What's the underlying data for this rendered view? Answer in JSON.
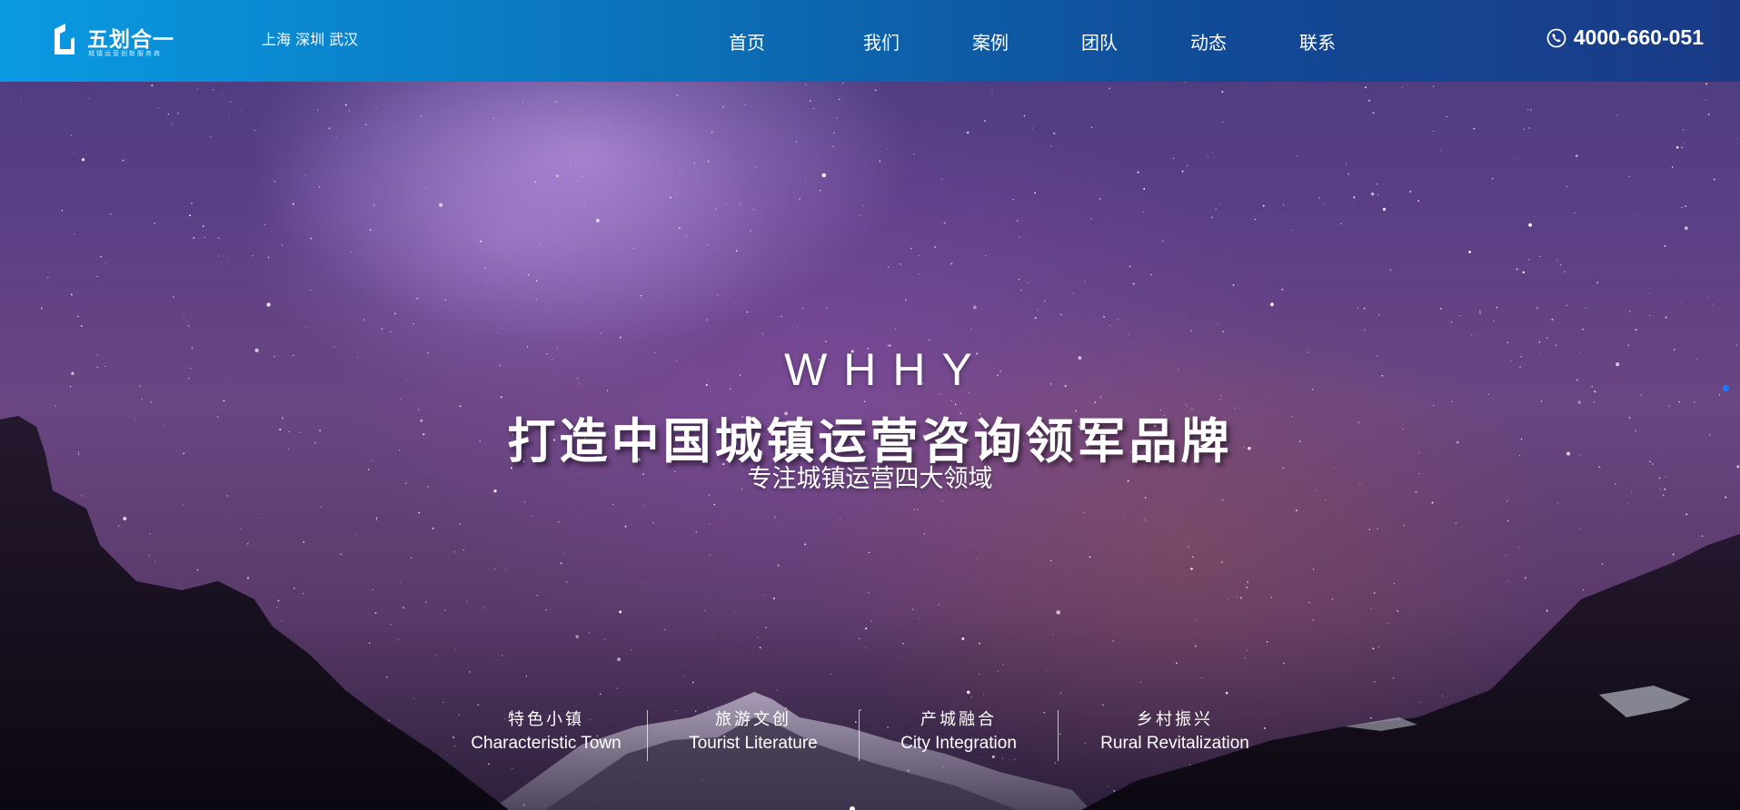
{
  "header": {
    "logo": {
      "name": "五划合一",
      "tagline": "城镇运营创新服务商"
    },
    "cities": "上海 深圳 武汉",
    "nav": [
      {
        "label": "首页"
      },
      {
        "label": "我们"
      },
      {
        "label": "案例"
      },
      {
        "label": "团队"
      },
      {
        "label": "动态"
      },
      {
        "label": "联系"
      }
    ],
    "phone": {
      "icon": "phone-icon",
      "number": "4000-660-051"
    }
  },
  "hero": {
    "brand": "WHHY",
    "title": "打造中国城镇运营咨询领军品牌",
    "subtitle": "专注城镇运营四大领域",
    "domains": [
      {
        "cn": "特色小镇",
        "en": "Characteristic Town"
      },
      {
        "cn": "旅游文创",
        "en": "Tourist Literature"
      },
      {
        "cn": "产城融合",
        "en": "City Integration"
      },
      {
        "cn": "乡村振兴",
        "en": "Rural Revitalization"
      }
    ]
  },
  "colors": {
    "header_start": "#0a9ae2",
    "header_end": "#1b3a86",
    "text": "#ffffff",
    "indicator": "#1e78ff"
  }
}
